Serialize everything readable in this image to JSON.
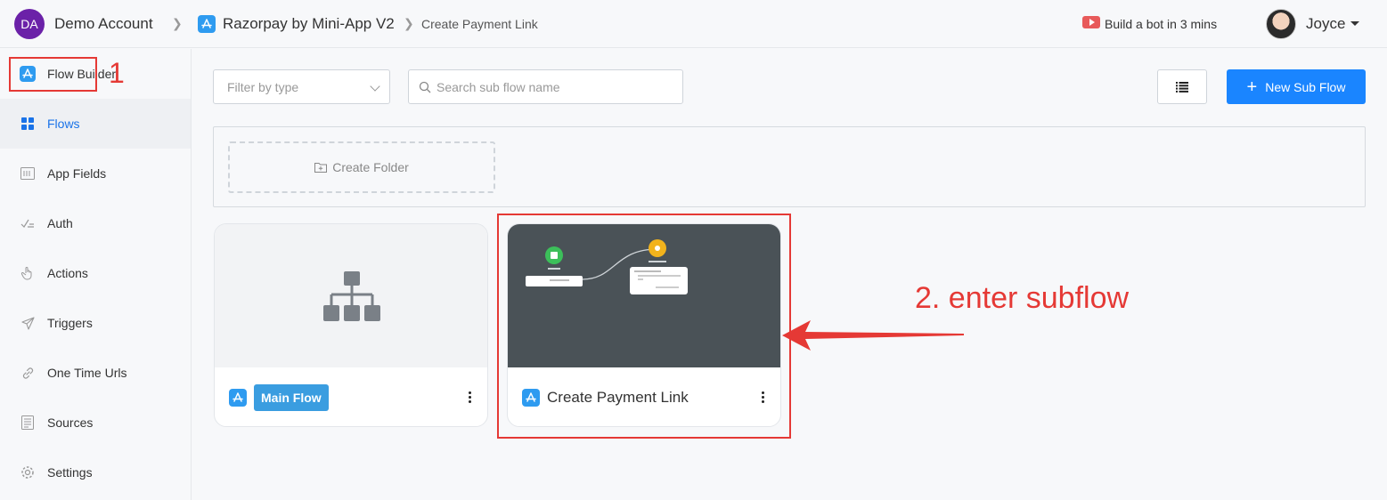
{
  "header": {
    "account_initials": "DA",
    "account_name": "Demo Account",
    "app_name": "Razorpay by Mini-App V2",
    "page_name": "Create Payment Link",
    "promo_text": "Build a bot in 3 mins",
    "user_name": "Joyce"
  },
  "sidebar": {
    "items": [
      {
        "label": "Flow Builder",
        "icon": "app-store-icon"
      },
      {
        "label": "Flows",
        "icon": "grid-icon"
      },
      {
        "label": "App Fields",
        "icon": "fields-icon"
      },
      {
        "label": "Auth",
        "icon": "auth-icon"
      },
      {
        "label": "Actions",
        "icon": "hand-pointer-icon"
      },
      {
        "label": "Triggers",
        "icon": "send-icon"
      },
      {
        "label": "One Time Urls",
        "icon": "link-icon"
      },
      {
        "label": "Sources",
        "icon": "document-icon"
      },
      {
        "label": "Settings",
        "icon": "gear-icon"
      }
    ],
    "active": "Flows"
  },
  "toolbar": {
    "filter_placeholder": "Filter by type",
    "search_placeholder": "Search sub flow name",
    "new_button_label": "New Sub Flow"
  },
  "folders": {
    "create_label": "Create Folder"
  },
  "cards": [
    {
      "label": "Main Flow",
      "type": "main"
    },
    {
      "label": "Create Payment Link",
      "type": "subflow"
    }
  ],
  "annotations": {
    "step1": "1",
    "step2": "2. enter subflow"
  },
  "colors": {
    "primary": "#1a85ff",
    "annotation": "#e53935",
    "badge": "#3a9de0",
    "thumb_dark": "#4a5257"
  }
}
